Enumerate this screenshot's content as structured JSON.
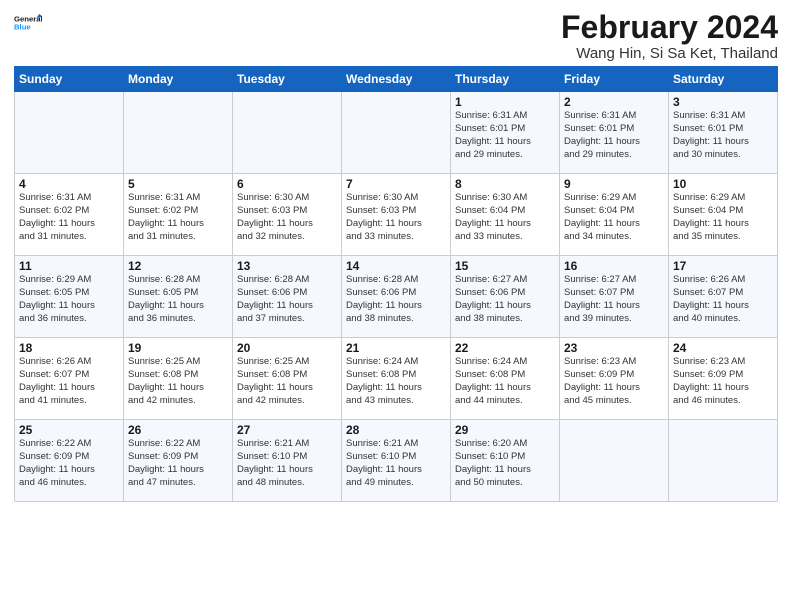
{
  "logo": {
    "line1": "General",
    "line2": "Blue"
  },
  "title": "February 2024",
  "subtitle": "Wang Hin, Si Sa Ket, Thailand",
  "headers": [
    "Sunday",
    "Monday",
    "Tuesday",
    "Wednesday",
    "Thursday",
    "Friday",
    "Saturday"
  ],
  "weeks": [
    [
      {
        "day": "",
        "info": ""
      },
      {
        "day": "",
        "info": ""
      },
      {
        "day": "",
        "info": ""
      },
      {
        "day": "",
        "info": ""
      },
      {
        "day": "1",
        "info": "Sunrise: 6:31 AM\nSunset: 6:01 PM\nDaylight: 11 hours\nand 29 minutes."
      },
      {
        "day": "2",
        "info": "Sunrise: 6:31 AM\nSunset: 6:01 PM\nDaylight: 11 hours\nand 29 minutes."
      },
      {
        "day": "3",
        "info": "Sunrise: 6:31 AM\nSunset: 6:01 PM\nDaylight: 11 hours\nand 30 minutes."
      }
    ],
    [
      {
        "day": "4",
        "info": "Sunrise: 6:31 AM\nSunset: 6:02 PM\nDaylight: 11 hours\nand 31 minutes."
      },
      {
        "day": "5",
        "info": "Sunrise: 6:31 AM\nSunset: 6:02 PM\nDaylight: 11 hours\nand 31 minutes."
      },
      {
        "day": "6",
        "info": "Sunrise: 6:30 AM\nSunset: 6:03 PM\nDaylight: 11 hours\nand 32 minutes."
      },
      {
        "day": "7",
        "info": "Sunrise: 6:30 AM\nSunset: 6:03 PM\nDaylight: 11 hours\nand 33 minutes."
      },
      {
        "day": "8",
        "info": "Sunrise: 6:30 AM\nSunset: 6:04 PM\nDaylight: 11 hours\nand 33 minutes."
      },
      {
        "day": "9",
        "info": "Sunrise: 6:29 AM\nSunset: 6:04 PM\nDaylight: 11 hours\nand 34 minutes."
      },
      {
        "day": "10",
        "info": "Sunrise: 6:29 AM\nSunset: 6:04 PM\nDaylight: 11 hours\nand 35 minutes."
      }
    ],
    [
      {
        "day": "11",
        "info": "Sunrise: 6:29 AM\nSunset: 6:05 PM\nDaylight: 11 hours\nand 36 minutes."
      },
      {
        "day": "12",
        "info": "Sunrise: 6:28 AM\nSunset: 6:05 PM\nDaylight: 11 hours\nand 36 minutes."
      },
      {
        "day": "13",
        "info": "Sunrise: 6:28 AM\nSunset: 6:06 PM\nDaylight: 11 hours\nand 37 minutes."
      },
      {
        "day": "14",
        "info": "Sunrise: 6:28 AM\nSunset: 6:06 PM\nDaylight: 11 hours\nand 38 minutes."
      },
      {
        "day": "15",
        "info": "Sunrise: 6:27 AM\nSunset: 6:06 PM\nDaylight: 11 hours\nand 38 minutes."
      },
      {
        "day": "16",
        "info": "Sunrise: 6:27 AM\nSunset: 6:07 PM\nDaylight: 11 hours\nand 39 minutes."
      },
      {
        "day": "17",
        "info": "Sunrise: 6:26 AM\nSunset: 6:07 PM\nDaylight: 11 hours\nand 40 minutes."
      }
    ],
    [
      {
        "day": "18",
        "info": "Sunrise: 6:26 AM\nSunset: 6:07 PM\nDaylight: 11 hours\nand 41 minutes."
      },
      {
        "day": "19",
        "info": "Sunrise: 6:25 AM\nSunset: 6:08 PM\nDaylight: 11 hours\nand 42 minutes."
      },
      {
        "day": "20",
        "info": "Sunrise: 6:25 AM\nSunset: 6:08 PM\nDaylight: 11 hours\nand 42 minutes."
      },
      {
        "day": "21",
        "info": "Sunrise: 6:24 AM\nSunset: 6:08 PM\nDaylight: 11 hours\nand 43 minutes."
      },
      {
        "day": "22",
        "info": "Sunrise: 6:24 AM\nSunset: 6:08 PM\nDaylight: 11 hours\nand 44 minutes."
      },
      {
        "day": "23",
        "info": "Sunrise: 6:23 AM\nSunset: 6:09 PM\nDaylight: 11 hours\nand 45 minutes."
      },
      {
        "day": "24",
        "info": "Sunrise: 6:23 AM\nSunset: 6:09 PM\nDaylight: 11 hours\nand 46 minutes."
      }
    ],
    [
      {
        "day": "25",
        "info": "Sunrise: 6:22 AM\nSunset: 6:09 PM\nDaylight: 11 hours\nand 46 minutes."
      },
      {
        "day": "26",
        "info": "Sunrise: 6:22 AM\nSunset: 6:09 PM\nDaylight: 11 hours\nand 47 minutes."
      },
      {
        "day": "27",
        "info": "Sunrise: 6:21 AM\nSunset: 6:10 PM\nDaylight: 11 hours\nand 48 minutes."
      },
      {
        "day": "28",
        "info": "Sunrise: 6:21 AM\nSunset: 6:10 PM\nDaylight: 11 hours\nand 49 minutes."
      },
      {
        "day": "29",
        "info": "Sunrise: 6:20 AM\nSunset: 6:10 PM\nDaylight: 11 hours\nand 50 minutes."
      },
      {
        "day": "",
        "info": ""
      },
      {
        "day": "",
        "info": ""
      }
    ]
  ]
}
